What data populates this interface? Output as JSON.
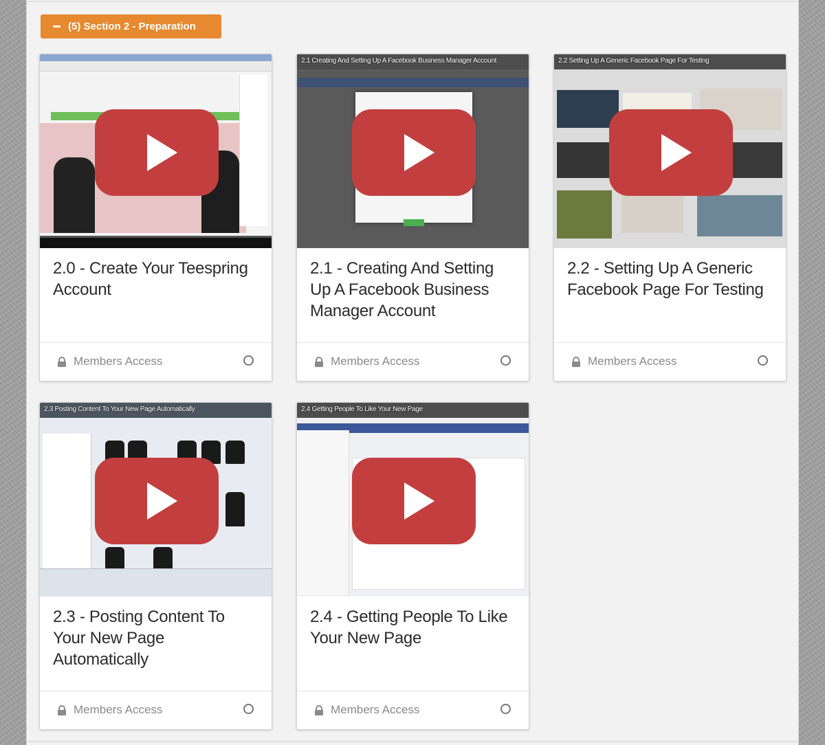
{
  "section": {
    "label": "(5) Section 2 - Preparation",
    "accent_color": "#e6892f"
  },
  "lessons": [
    {
      "thumb_caption": "",
      "title": "2.0 - Create Your Teespring Account",
      "access": "Members Access",
      "status_icon": "circle-outline-icon"
    },
    {
      "thumb_caption": "2.1 Creating And Setting Up A Facebook Business Manager Account",
      "title": "2.1 - Creating And Setting Up A Facebook Business Manager Account",
      "access": "Members Access",
      "status_icon": "circle-outline-icon"
    },
    {
      "thumb_caption": "2.2 Setting Up A Generic Facebook Page For Testing",
      "title": "2.2 - Setting Up A Generic Facebook Page For Testing",
      "access": "Members Access",
      "status_icon": "circle-outline-icon"
    },
    {
      "thumb_caption": "2.3 Posting Content To Your New Page Automatically",
      "title": "2.3 - Posting Content To Your New Page Automatically",
      "access": "Members Access",
      "status_icon": "circle-outline-icon"
    },
    {
      "thumb_caption": "2.4 Getting People To Like Your New Page",
      "title": "2.4 - Getting People To Like Your New Page",
      "access": "Members Access",
      "status_icon": "circle-outline-icon"
    }
  ],
  "colors": {
    "play_button": "#c33f3f",
    "panel_bg": "#f2f2f2",
    "title_text": "#2c2c2c",
    "muted_text": "#8a8a8a"
  }
}
